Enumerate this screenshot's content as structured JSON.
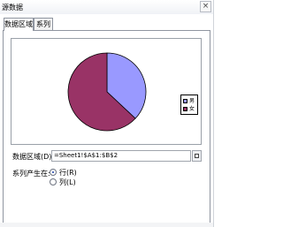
{
  "window": {
    "title": "源数据",
    "close_label": "×"
  },
  "tabs": [
    {
      "label": "数据区域",
      "active": true
    },
    {
      "label": "系列",
      "active": false
    }
  ],
  "chart": {
    "type": "pie",
    "legend": [
      {
        "label": "男",
        "color": "#9999ff"
      },
      {
        "label": "女",
        "color": "#993366"
      }
    ],
    "values": [
      37,
      63
    ],
    "outline_color": "#000000"
  },
  "data_range": {
    "label": "数据区域(D):",
    "value": "=Sheet1!$A$1:$B$2"
  },
  "series_in": {
    "label": "系列产生在:",
    "options": [
      {
        "label": "行(R)",
        "checked": true
      },
      {
        "label": "列(L)",
        "checked": false
      }
    ]
  }
}
